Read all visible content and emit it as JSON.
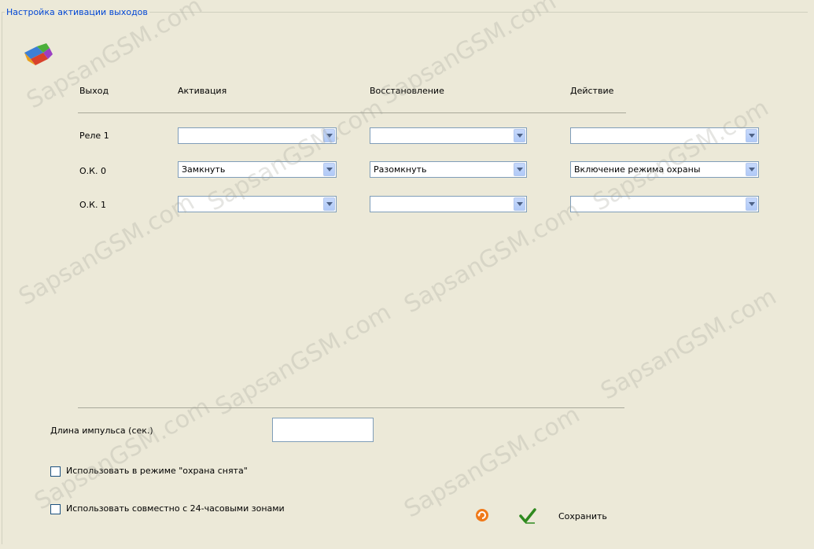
{
  "groupbox_title": "Настройка активации выходов",
  "columns": {
    "output": "Выход",
    "activation": "Активация",
    "restore": "Восстановление",
    "action": "Действие"
  },
  "rows": [
    {
      "label": "Реле 1",
      "activation": "",
      "restore": "",
      "action": ""
    },
    {
      "label": "О.К. 0",
      "activation": "Замкнуть",
      "restore": "Разомкнуть",
      "action": "Включение режима охраны"
    },
    {
      "label": "О.К. 1",
      "activation": "",
      "restore": "",
      "action": ""
    }
  ],
  "pulse_length": {
    "label": "Длина импульса (сек.)",
    "value": ""
  },
  "checkboxes": {
    "disarmed_mode": {
      "label": "Использовать в режиме \"охрана снята\"",
      "checked": false
    },
    "zones_24h": {
      "label": "Использовать совместно с 24-часовыми зонами",
      "checked": false
    }
  },
  "footer": {
    "save_label": "Сохранить"
  },
  "watermark": "SapsanGSM.com",
  "icons": {
    "app": "app-logo-icon",
    "refresh": "refresh-icon",
    "save": "checkmark-icon"
  }
}
